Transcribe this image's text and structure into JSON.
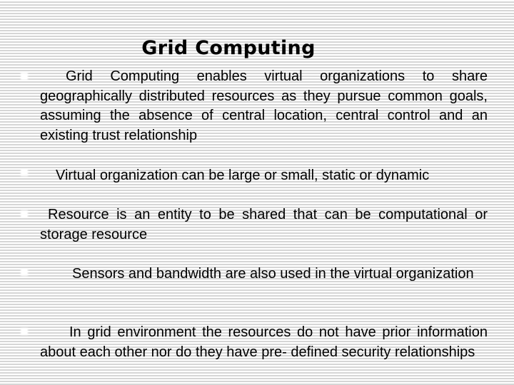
{
  "slide": {
    "title": "Grid Computing",
    "bullets": [
      {
        "text": "Grid Computing enables virtual organizations to share geographically distributed resources as they pursue common goals, assuming the absence of central location, central control and an existing trust relationship",
        "icon": "square-bullet-icon"
      },
      {
        "text": "Virtual organization can be large or small, static or dynamic",
        "icon": "square-bullet-icon"
      },
      {
        "text": "Resource is an entity to be shared that can be computational or storage resource",
        "icon": "square-bullet-icon"
      },
      {
        "text": "Sensors and bandwidth are also used in the virtual organization",
        "icon": "square-bullet-icon"
      },
      {
        "text": "In grid environment the resources do not have prior information about each other nor do they have pre- defined security relationships",
        "icon": "square-bullet-icon"
      }
    ]
  }
}
